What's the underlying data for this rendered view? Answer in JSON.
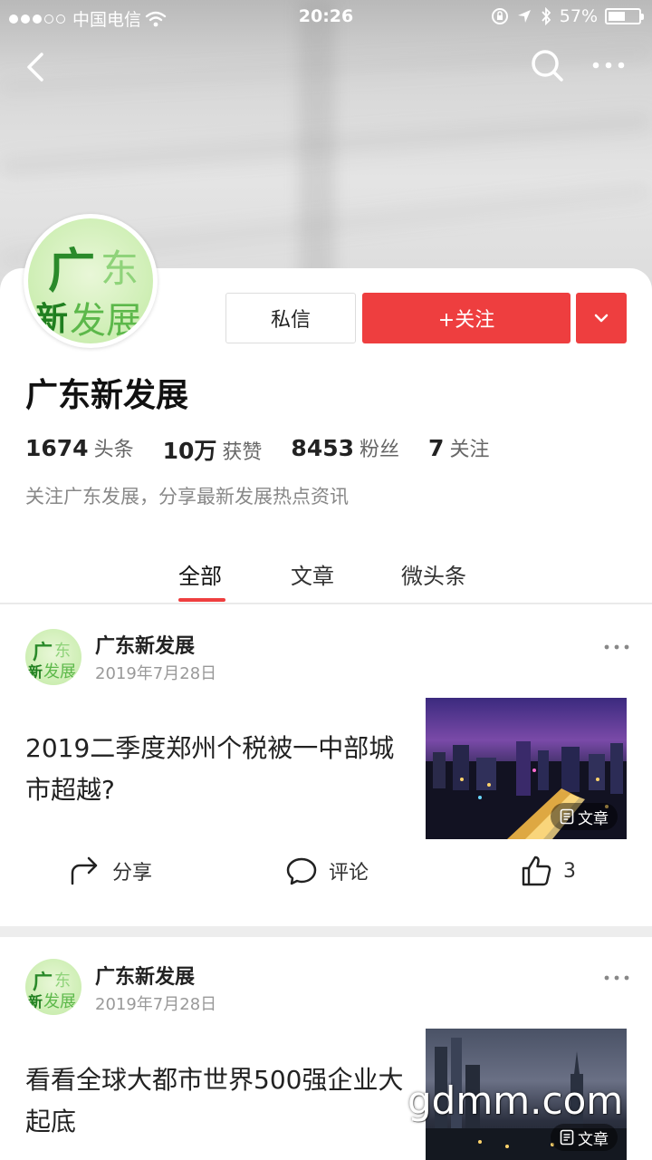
{
  "status_bar": {
    "carrier": "中国电信",
    "time": "20:26",
    "battery_text": "57%",
    "battery_level": 0.57,
    "signal_bars": 3
  },
  "nav": {
    "back_icon": "chevron-left-icon",
    "search_icon": "search-icon",
    "more_icon": "more-horizontal-icon"
  },
  "profile": {
    "avatar_text": [
      "广",
      "东",
      "新",
      "发展"
    ],
    "name": "广东新发展",
    "message_label": "私信",
    "follow_label": "+关注",
    "stats": [
      {
        "num": "1674",
        "label": "头条"
      },
      {
        "num": "10万",
        "label": "获赞"
      },
      {
        "num": "8453",
        "label": "粉丝"
      },
      {
        "num": "7",
        "label": "关注"
      }
    ],
    "bio": "关注广东发展，分享最新发展热点资讯"
  },
  "tabs": [
    {
      "label": "全部",
      "active": true
    },
    {
      "label": "文章",
      "active": false
    },
    {
      "label": "微头条",
      "active": false
    }
  ],
  "feed": [
    {
      "author": "广东新发展",
      "date": "2019年7月28日",
      "title": "2019二季度郑州个税被一中部城市超越?",
      "badge": "文章",
      "actions": {
        "share": "分享",
        "comment": "评论",
        "like_count": "3"
      }
    },
    {
      "author": "广东新发展",
      "date": "2019年7月28日",
      "title": "看看全球大都市世界500强企业大起底",
      "badge": "文章"
    }
  ],
  "watermark": "gdmm.com",
  "colors": {
    "accent": "#ee3e3f",
    "text": "#222222",
    "muted": "#888888"
  }
}
